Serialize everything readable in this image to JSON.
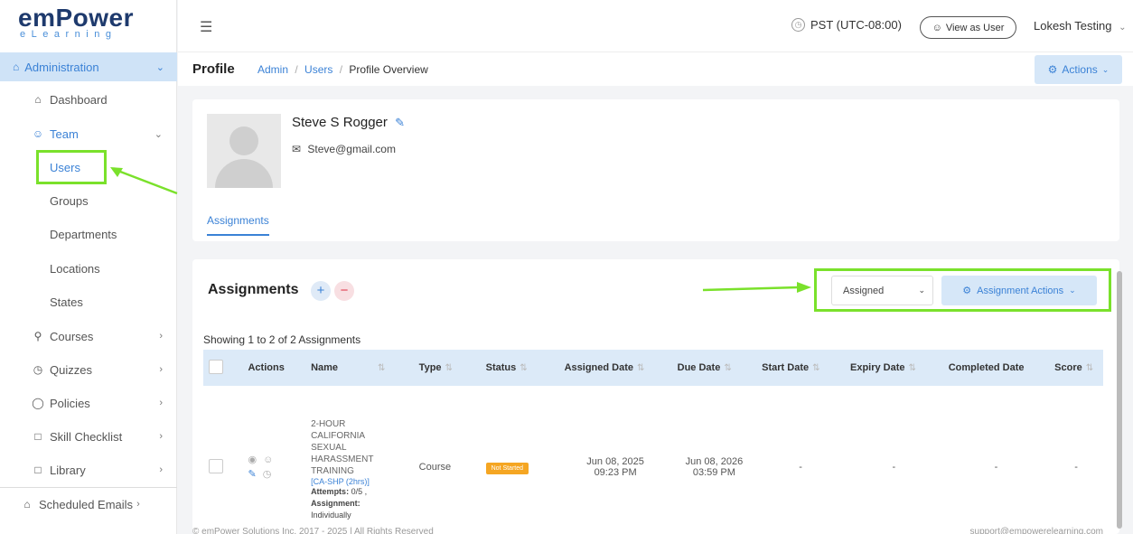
{
  "logo": {
    "main": "emPower",
    "sub": "eLearning"
  },
  "sidebar": {
    "section": "Administration",
    "items": [
      {
        "label": "Dashboard",
        "icon": "home-icon"
      },
      {
        "label": "Team",
        "icon": "team-icon"
      },
      {
        "label": "Users"
      },
      {
        "label": "Groups"
      },
      {
        "label": "Departments"
      },
      {
        "label": "Locations"
      },
      {
        "label": "States"
      },
      {
        "label": "Courses",
        "icon": "course-icon"
      },
      {
        "label": "Quizzes",
        "icon": "quiz-icon"
      },
      {
        "label": "Policies",
        "icon": "policy-icon"
      },
      {
        "label": "Skill Checklist",
        "icon": "checklist-icon"
      },
      {
        "label": "Library",
        "icon": "library-icon"
      },
      {
        "label": "Scheduled Emails",
        "icon": "email-icon"
      }
    ]
  },
  "topbar": {
    "timezone": "PST (UTC-08:00)",
    "view_as_user": "View as User",
    "user_name": "Lokesh Testing"
  },
  "breadcrumb": {
    "title": "Profile",
    "admin": "Admin",
    "users": "Users",
    "current": "Profile Overview",
    "actions": "Actions"
  },
  "profile": {
    "name": "Steve S Rogger",
    "email": "Steve@gmail.com",
    "tab": "Assignments"
  },
  "assignments": {
    "title": "Assignments",
    "filter_value": "Assigned",
    "actions_label": "Assignment Actions",
    "showing": "Showing 1 to 2 of 2 Assignments",
    "columns": [
      "Actions",
      "Name",
      "Type",
      "Status",
      "Assigned Date",
      "Due Date",
      "Start Date",
      "Expiry Date",
      "Completed Date",
      "Score"
    ],
    "rows": [
      {
        "name": "2-HOUR CALIFORNIA SEXUAL HARASSMENT TRAINING",
        "code": "[CA-SHP (2hrs)]",
        "attempts_label": "Attempts:",
        "attempts_value": "0/5 ,",
        "assignment_label": "Assignment:",
        "assignment_value": "Individually",
        "type": "Course",
        "status": "Not Started",
        "assigned_date": "Jun 08, 2025 09:23 PM",
        "due_date": "Jun 08, 2026 03:59 PM",
        "start_date": "-",
        "expiry_date": "-",
        "completed_date": "-",
        "score": "-"
      }
    ]
  },
  "footer": {
    "left": "© emPower Solutions Inc. 2017 - 2025 | All Rights Reserved",
    "right": "support@empowerelearning.com"
  },
  "colors": {
    "brand": "#1e3a6d",
    "accent": "#3b82d6",
    "highlight": "#7ae12b",
    "badge": "#f5a623"
  }
}
